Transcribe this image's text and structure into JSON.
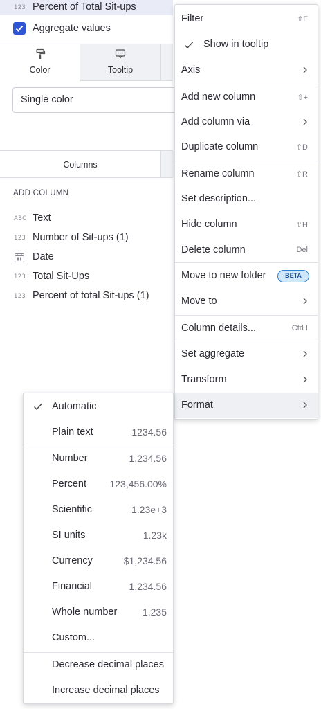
{
  "field_row": {
    "type": "123",
    "label": "Percent of Total Sit-ups"
  },
  "aggregate": {
    "label": "Aggregate values",
    "checked": true
  },
  "tabs": [
    {
      "label": "Color",
      "icon": "paint-roller-icon"
    },
    {
      "label": "Tooltip",
      "icon": "tooltip-icon"
    }
  ],
  "color_select": {
    "value": "Single color"
  },
  "columns_tab": {
    "label": "Columns"
  },
  "add_column_label": "ADD COLUMN",
  "columns": [
    {
      "type": "ABC",
      "name": "Text"
    },
    {
      "type": "123",
      "name": "Number of Sit-ups (1)"
    },
    {
      "type": "date-icon",
      "name": "Date"
    },
    {
      "type": "123",
      "name": "Total Sit-Ups"
    },
    {
      "type": "123",
      "name": "Percent of total Sit-ups (1)"
    }
  ],
  "context_menu": {
    "filter": {
      "label": "Filter",
      "shortcut": "⇧F"
    },
    "show_in_tooltip": {
      "label": "Show in tooltip",
      "checked": true
    },
    "axis": {
      "label": "Axis"
    },
    "add_new_column": {
      "label": "Add new column",
      "shortcut": "⇧+"
    },
    "add_column_via": {
      "label": "Add column via"
    },
    "duplicate_column": {
      "label": "Duplicate column",
      "shortcut": "⇧D"
    },
    "rename_column": {
      "label": "Rename column",
      "shortcut": "⇧R"
    },
    "set_description": {
      "label": "Set description..."
    },
    "hide_column": {
      "label": "Hide column",
      "shortcut": "⇧H"
    },
    "delete_column": {
      "label": "Delete column",
      "shortcut": "Del"
    },
    "move_to_new_folder": {
      "label": "Move to new folder",
      "badge": "BETA"
    },
    "move_to": {
      "label": "Move to"
    },
    "column_details": {
      "label": "Column details...",
      "shortcut": "Ctrl I"
    },
    "set_aggregate": {
      "label": "Set aggregate"
    },
    "transform": {
      "label": "Transform"
    },
    "format": {
      "label": "Format"
    }
  },
  "format_menu": {
    "automatic": {
      "label": "Automatic",
      "checked": true
    },
    "plain_text": {
      "label": "Plain text",
      "example": "1234.56"
    },
    "number": {
      "label": "Number",
      "example": "1,234.56"
    },
    "percent": {
      "label": "Percent",
      "example": "123,456.00%"
    },
    "scientific": {
      "label": "Scientific",
      "example": "1.23e+3"
    },
    "si_units": {
      "label": "SI units",
      "example": "1.23k"
    },
    "currency": {
      "label": "Currency",
      "example": "$1,234.56"
    },
    "financial": {
      "label": "Financial",
      "example": "1,234.56"
    },
    "whole_number": {
      "label": "Whole number",
      "example": "1,235"
    },
    "custom": {
      "label": "Custom..."
    },
    "decrease_decimal": {
      "label": "Decrease decimal places"
    },
    "increase_decimal": {
      "label": "Increase decimal places"
    }
  },
  "colors": {
    "accent": "#2f55d4",
    "highlight_row": "#e9ecf7",
    "beta_border": "#2f7fd0",
    "beta_fill": "#cfe7fb"
  }
}
